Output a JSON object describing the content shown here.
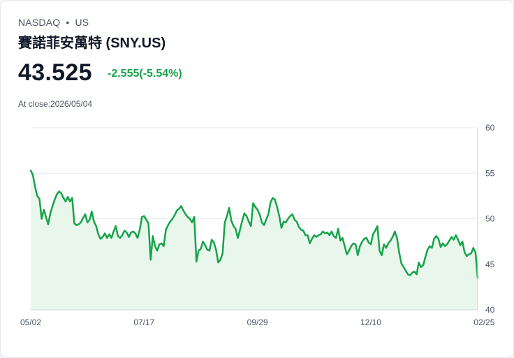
{
  "header": {
    "exchange": "NASDAQ",
    "separator": "•",
    "market": "US",
    "name": "賽諾菲安萬特 (SNY.US)",
    "price": "43.525",
    "change": "-2.555(-5.54%)",
    "as_of": "At close:2026/05/04"
  },
  "colors": {
    "line": "#16a34a",
    "fill": "#e8f6ec",
    "grid": "#e5e7eb",
    "change": "#16a34a"
  },
  "chart_data": {
    "type": "area",
    "ylim": [
      40,
      60
    ],
    "y_ticks": [
      "60",
      "55",
      "50",
      "45",
      "40"
    ],
    "x_tick_labels": [
      "05/02",
      "07/17",
      "09/29",
      "12/10",
      "02/25"
    ],
    "x_tick_index": [
      0,
      52,
      104,
      156,
      208
    ],
    "grid": true,
    "values": [
      55.3,
      54.8,
      53.5,
      52.5,
      52.2,
      50.0,
      51.0,
      50.2,
      49.4,
      50.6,
      51.4,
      52.1,
      52.7,
      53.0,
      52.8,
      52.3,
      51.9,
      52.4,
      51.9,
      52.3,
      49.5,
      49.3,
      49.4,
      49.6,
      50.1,
      50.5,
      49.6,
      49.9,
      50.8,
      49.7,
      49.2,
      48.3,
      47.8,
      48.0,
      48.4,
      47.9,
      48.3,
      47.9,
      48.6,
      49.2,
      48.1,
      47.9,
      48.2,
      48.7,
      48.5,
      48.0,
      48.5,
      48.6,
      48.4,
      47.9,
      48.8,
      50.2,
      50.3,
      49.9,
      49.5,
      45.5,
      48.1,
      47.0,
      46.5,
      47.2,
      47.3,
      47.0,
      48.8,
      49.3,
      49.7,
      50.0,
      50.4,
      50.9,
      51.1,
      51.4,
      50.9,
      50.5,
      50.2,
      50.0,
      49.6,
      50.2,
      45.3,
      46.5,
      46.7,
      47.5,
      47.1,
      46.6,
      46.5,
      47.7,
      47.4,
      46.6,
      45.2,
      45.5,
      46.2,
      49.6,
      50.3,
      51.2,
      49.8,
      49.2,
      48.9,
      47.9,
      48.8,
      49.8,
      50.6,
      50.3,
      49.7,
      49.2,
      51.7,
      51.3,
      51.0,
      50.5,
      49.6,
      49.3,
      49.9,
      50.5,
      51.8,
      52.3,
      52.1,
      51.3,
      50.3,
      49.0,
      49.7,
      49.6,
      50.0,
      50.3,
      50.5,
      49.9,
      49.7,
      49.1,
      48.8,
      48.7,
      48.2,
      48.2,
      47.3,
      47.8,
      48.2,
      48.0,
      48.2,
      48.3,
      48.6,
      48.4,
      48.5,
      48.2,
      48.6,
      48.1,
      47.9,
      48.9,
      47.6,
      47.9,
      47.0,
      46.1,
      46.5,
      47.0,
      47.3,
      47.2,
      46.0,
      47.0,
      47.5,
      47.8,
      47.9,
      47.4,
      47.2,
      48.3,
      48.7,
      49.2,
      46.5,
      46.0,
      47.2,
      46.8,
      47.3,
      47.6,
      48.0,
      48.6,
      47.9,
      46.3,
      45.1,
      44.7,
      44.3,
      43.9,
      43.8,
      44.1,
      44.2,
      43.9,
      45.2,
      44.7,
      44.9,
      45.8,
      46.6,
      47.0,
      46.8,
      47.8,
      48.1,
      47.8,
      46.9,
      47.3,
      47.0,
      47.2,
      47.6,
      48.0,
      47.7,
      48.2,
      47.7,
      47.1,
      47.5,
      46.3,
      45.9,
      46.1,
      46.2,
      46.8,
      46.3,
      43.5
    ]
  }
}
